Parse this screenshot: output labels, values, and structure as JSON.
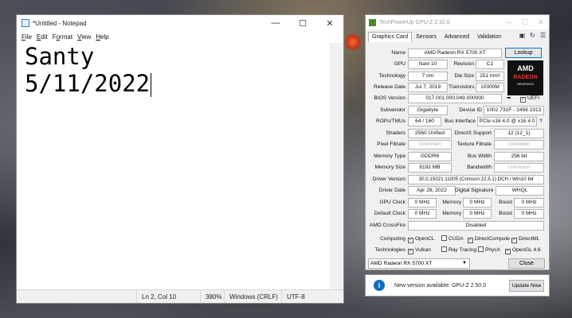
{
  "notepad": {
    "title": "*Untitled - Notepad",
    "menu": [
      {
        "u": "F",
        "rest": "ile"
      },
      {
        "u": "E",
        "rest": "dit"
      },
      {
        "pre": "F",
        "u": "o",
        "rest": "rmat"
      },
      {
        "u": "V",
        "rest": "iew"
      },
      {
        "u": "H",
        "rest": "elp"
      }
    ],
    "text_line1": "Santy",
    "text_line2": "5/11/2022",
    "status": {
      "position": "Ln 2, Col 10",
      "zoom": "380%",
      "line_ending": "Windows (CRLF)",
      "encoding": "UTF-8"
    }
  },
  "gpuz": {
    "title": "TechPowerUp GPU-Z 2.32.0",
    "tabs": [
      "Graphics Card",
      "Sensors",
      "Advanced",
      "Validation"
    ],
    "lookup_label": "Lookup",
    "logo": {
      "brand": "AMD",
      "line": "RADEON",
      "sub": "GRAPHICS"
    },
    "labels": {
      "name": "Name",
      "gpu": "GPU",
      "revision": "Revision",
      "technology": "Technology",
      "die_size": "Die Size",
      "release_date": "Release Date",
      "transistors": "Transistors",
      "bios": "BIOS Version",
      "uefi": "UEFI",
      "subvendor": "Subvendor",
      "device_id": "Device ID",
      "rops": "ROPs/TMUs",
      "bus_interface": "Bus Interface",
      "shaders": "Shaders",
      "directx": "DirectX Support",
      "pixel_fillrate": "Pixel Fillrate",
      "texture_fillrate": "Texture Fillrate",
      "memory_type": "Memory Type",
      "bus_width": "Bus Width",
      "memory_size": "Memory Size",
      "bandwidth": "Bandwidth",
      "driver_version": "Driver Version",
      "driver_date": "Driver Date",
      "digital_signature": "Digital Signature",
      "gpu_clock": "GPU Clock",
      "memory": "Memory",
      "boost": "Boost",
      "default_clock": "Default Clock",
      "crossfire": "AMD CrossFire",
      "computing": "Computing",
      "technologies": "Technologies"
    },
    "values": {
      "name": "AMD Radeon RX 5700 XT",
      "gpu": "Navi 10",
      "revision": "C1",
      "technology": "7 nm",
      "die_size": "251 mm²",
      "release_date": "Jul 7, 2019",
      "transistors": "10300M",
      "bios": "017.001.000.049.000000",
      "subvendor": "Gigabyte",
      "device_id": "1002 731F - 1458 2313",
      "rops": "64 / 160",
      "bus_interface": "PCIe x16 4.0 @ x16 4.0",
      "bus_help": "?",
      "shaders": "2560 Unified",
      "directx": "12 (12_1)",
      "pixel_fillrate": "Unknown",
      "texture_fillrate": "Unknown",
      "memory_type": "GDDR6",
      "bus_width": "256 bit",
      "memory_size": "8192 MB",
      "bandwidth": "Unknown",
      "driver_version": "30.0.15021.11005 (Crimson 22.5.1) DCH / Win10 64",
      "driver_date": "Apr 28, 2022",
      "digital_signature": "WHQL",
      "gpu_clock": "0 MHz",
      "gpu_memory": "0 MHz",
      "gpu_boost": "0 MHz",
      "default_clock": "0 MHz",
      "default_memory": "0 MHz",
      "default_boost": "0 MHz",
      "crossfire": "Disabled"
    },
    "computing": [
      "OpenCL",
      "CUDA",
      "DirectCompute",
      "DirectML"
    ],
    "computing_checked": [
      true,
      false,
      true,
      true
    ],
    "technologies": [
      "Vulkan",
      "Ray Tracing",
      "PhysX",
      "OpenGL 4.6"
    ],
    "technologies_checked": [
      true,
      false,
      false,
      true
    ],
    "selected_card": "AMD Radeon RX 5700 XT",
    "close_label": "Close",
    "update": {
      "text": "New version available: GPU-Z 2.50.0",
      "button": "Update Now"
    }
  }
}
